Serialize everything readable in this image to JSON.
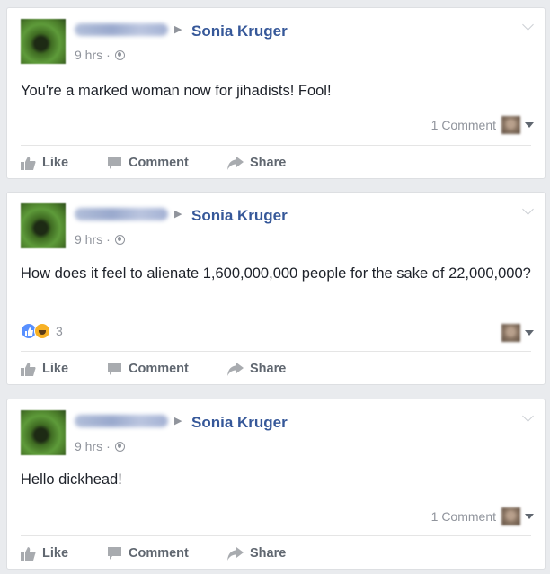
{
  "posts": [
    {
      "page_name": "Sonia Kruger",
      "time": "9 hrs",
      "text": "You're a marked woman now for jihadists! Fool!",
      "comment_count": "1 Comment",
      "reaction_count": "",
      "actions": {
        "like": "Like",
        "comment": "Comment",
        "share": "Share"
      }
    },
    {
      "page_name": "Sonia Kruger",
      "time": "9 hrs",
      "text": "How does it feel to alienate 1,600,000,000 people for the sake of 22,000,000?",
      "comment_count": "",
      "reaction_count": "3",
      "actions": {
        "like": "Like",
        "comment": "Comment",
        "share": "Share"
      }
    },
    {
      "page_name": "Sonia Kruger",
      "time": "9 hrs",
      "text": "Hello dickhead!",
      "comment_count": "1 Comment",
      "reaction_count": "",
      "actions": {
        "like": "Like",
        "comment": "Comment",
        "share": "Share"
      }
    }
  ],
  "icons": {
    "privacy": "globe-icon",
    "like": "thumbs-up-icon",
    "comment": "comment-bubble-icon",
    "share": "share-arrow-icon",
    "reactions": [
      "like-reaction-icon",
      "haha-reaction-icon"
    ]
  },
  "colors": {
    "link": "#365899",
    "meta": "#90949c",
    "action": "#606770",
    "background": "#e9ebee",
    "like_reaction": "#5890ff",
    "haha_reaction": "#f7b125"
  }
}
